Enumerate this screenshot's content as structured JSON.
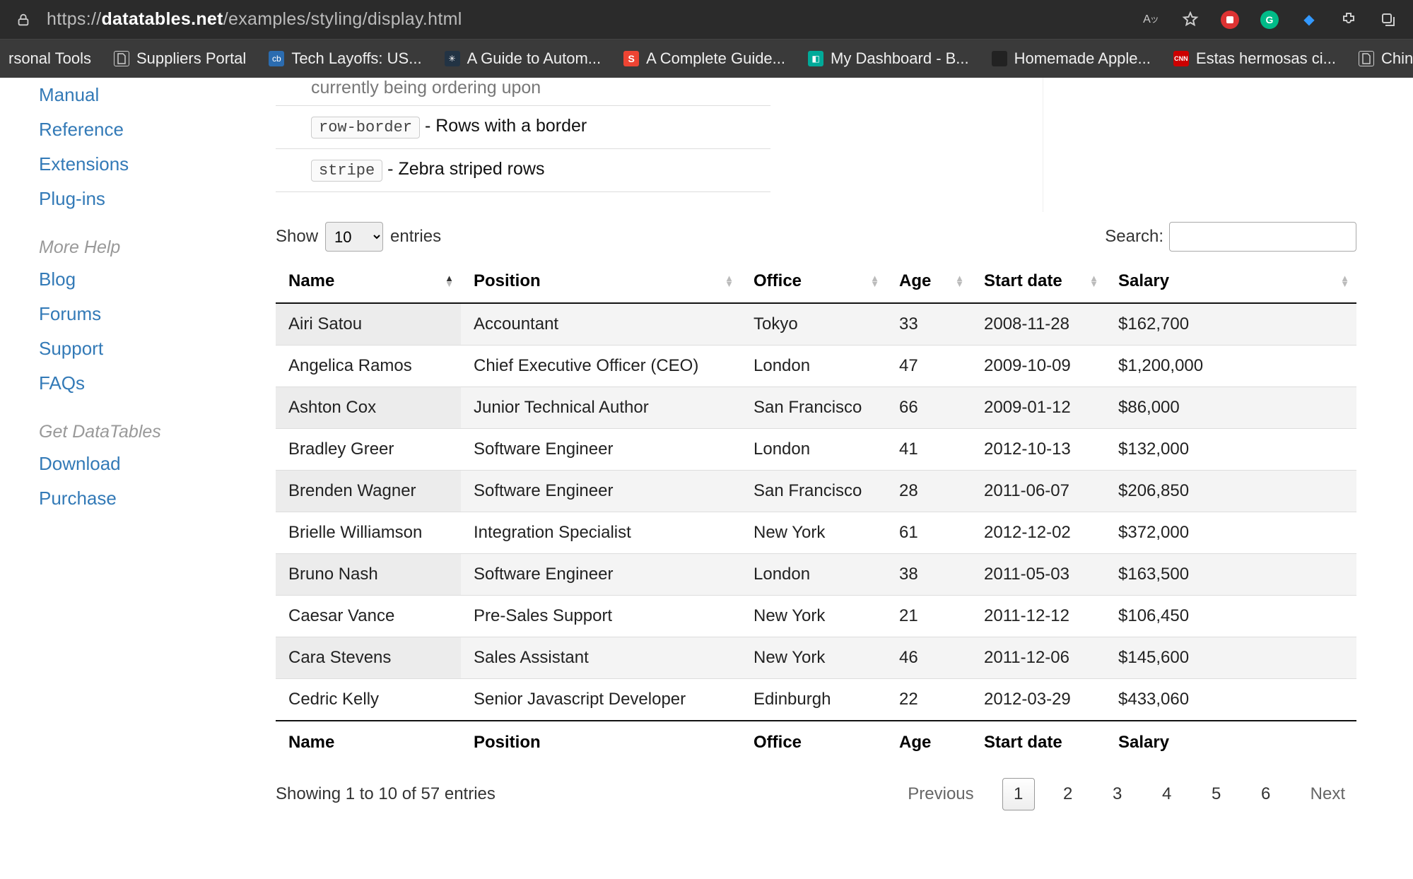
{
  "browser": {
    "url_prefix": "https://",
    "url_domain": "datatables.net",
    "url_path": "/examples/styling/display.html"
  },
  "bookmarks": [
    {
      "label": "rsonal Tools",
      "favicon": ""
    },
    {
      "label": "Suppliers Portal",
      "favicon": "doc"
    },
    {
      "label": "Tech Layoffs: US...",
      "favicon": "cb"
    },
    {
      "label": "A Guide to Autom...",
      "favicon": "spin"
    },
    {
      "label": "A Complete Guide...",
      "favicon": "S"
    },
    {
      "label": "My Dashboard - B...",
      "favicon": "teal"
    },
    {
      "label": "Homemade Apple...",
      "favicon": "dark"
    },
    {
      "label": "Estas hermosas ci...",
      "favicon": "cnn"
    },
    {
      "label": "Chinese",
      "favicon": "doc"
    }
  ],
  "sidebar": {
    "links_a": [
      "Manual",
      "Reference",
      "Extensions",
      "Plug-ins"
    ],
    "section_b": "More Help",
    "links_b": [
      "Blog",
      "Forums",
      "Support",
      "FAQs"
    ],
    "section_c": "Get DataTables",
    "links_c": [
      "Download",
      "Purchase"
    ]
  },
  "options": {
    "cutoff": "currently being ordering upon",
    "items": [
      {
        "code": "row-border",
        "desc": "Rows with a border"
      },
      {
        "code": "stripe",
        "desc": "Zebra striped rows"
      }
    ]
  },
  "length": {
    "show": "Show",
    "value": "10",
    "entries": "entries"
  },
  "search": {
    "label": "Search:",
    "value": ""
  },
  "columns": [
    "Name",
    "Position",
    "Office",
    "Age",
    "Start date",
    "Salary"
  ],
  "rows": [
    [
      "Airi Satou",
      "Accountant",
      "Tokyo",
      "33",
      "2008-11-28",
      "$162,700"
    ],
    [
      "Angelica Ramos",
      "Chief Executive Officer (CEO)",
      "London",
      "47",
      "2009-10-09",
      "$1,200,000"
    ],
    [
      "Ashton Cox",
      "Junior Technical Author",
      "San Francisco",
      "66",
      "2009-01-12",
      "$86,000"
    ],
    [
      "Bradley Greer",
      "Software Engineer",
      "London",
      "41",
      "2012-10-13",
      "$132,000"
    ],
    [
      "Brenden Wagner",
      "Software Engineer",
      "San Francisco",
      "28",
      "2011-06-07",
      "$206,850"
    ],
    [
      "Brielle Williamson",
      "Integration Specialist",
      "New York",
      "61",
      "2012-12-02",
      "$372,000"
    ],
    [
      "Bruno Nash",
      "Software Engineer",
      "London",
      "38",
      "2011-05-03",
      "$163,500"
    ],
    [
      "Caesar Vance",
      "Pre-Sales Support",
      "New York",
      "21",
      "2011-12-12",
      "$106,450"
    ],
    [
      "Cara Stevens",
      "Sales Assistant",
      "New York",
      "46",
      "2011-12-06",
      "$145,600"
    ],
    [
      "Cedric Kelly",
      "Senior Javascript Developer",
      "Edinburgh",
      "22",
      "2012-03-29",
      "$433,060"
    ]
  ],
  "info": "Showing 1 to 10 of 57 entries",
  "paginate": {
    "previous": "Previous",
    "next": "Next",
    "pages": [
      "1",
      "2",
      "3",
      "4",
      "5",
      "6"
    ],
    "active": "1"
  }
}
